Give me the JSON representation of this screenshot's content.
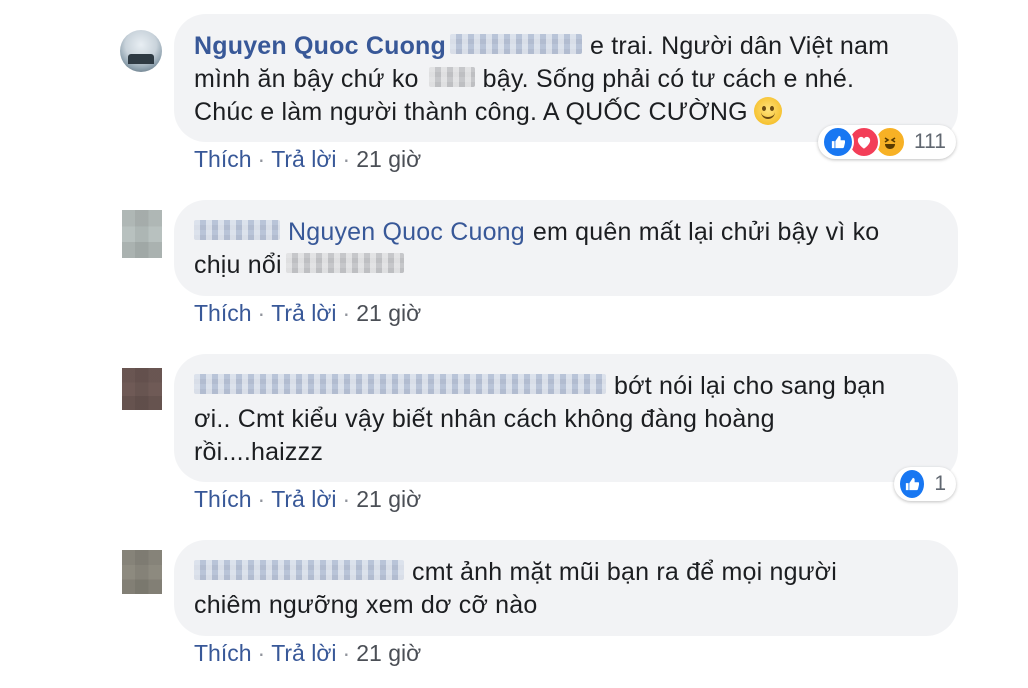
{
  "comments": [
    {
      "author": "Nguyen Quoc Cuong",
      "line1_after": "e trai. Người dân Việt nam",
      "line2_before": "mình ăn bậy chứ ko",
      "line2_after": "bậy. Sống phải có tư cách e nhé.",
      "line3": "Chúc e làm người thành công. A QUỐC CƯỜNG",
      "emoji": "slightly-smiling-face-icon",
      "reactions": {
        "types": [
          "like",
          "love",
          "haha"
        ],
        "count": "111"
      },
      "actions": {
        "like": "Thích",
        "reply": "Trả lời",
        "time": "21 giờ"
      }
    },
    {
      "tagged": "Nguyen Quoc Cuong",
      "line1_after": "em quên mất lại chửi bậy vì ko",
      "line2_before": "chịu nổi",
      "actions": {
        "like": "Thích",
        "reply": "Trả lời",
        "time": "21 giờ"
      }
    },
    {
      "line1_after": "bớt nói lại cho sang bạn",
      "line2": "ơi.. Cmt kiểu vậy biết nhân cách không đàng hoàng",
      "line3": "rồi....haizzz",
      "reactions": {
        "types": [
          "like"
        ],
        "count": "1"
      },
      "actions": {
        "like": "Thích",
        "reply": "Trả lời",
        "time": "21 giờ"
      }
    },
    {
      "line1_after": "cmt ảnh mặt mũi bạn ra để mọi người",
      "line2": "chiêm ngưỡng xem dơ cỡ nào",
      "actions": {
        "like": "Thích",
        "reply": "Trả lời",
        "time": "21 giờ"
      }
    }
  ],
  "colors": {
    "link": "#385898",
    "bubble": "#f2f3f5",
    "like": "#1877f2",
    "love": "#f33e58",
    "haha": "#f7b125"
  },
  "separator": "·"
}
